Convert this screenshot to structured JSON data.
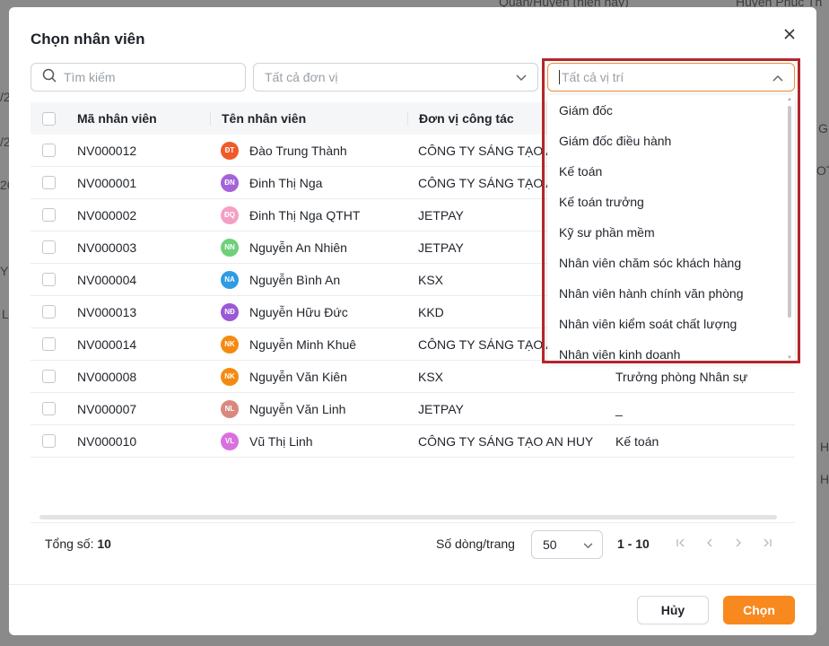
{
  "background": {
    "partial_texts": [
      "Quận/Huyện (hiện nay)",
      "Huyện Phúc Th",
      "/2",
      "/2",
      "26",
      "G",
      "OTH",
      "Y",
      "L",
      "H",
      "H"
    ]
  },
  "modal": {
    "title": "Chọn nhân viên",
    "search": {
      "placeholder": "Tìm kiếm"
    },
    "unit_select": {
      "placeholder": "Tất cả đơn vị"
    },
    "position_select": {
      "placeholder": "Tất cả vị trí"
    },
    "table": {
      "headers": [
        "Mã nhân viên",
        "Tên nhân viên",
        "Đơn vị công tác"
      ],
      "rows": [
        {
          "code": "NV000012",
          "initials": "ĐT",
          "avatar_color": "#f05a28",
          "name": "Đào Trung Thành",
          "unit": "CÔNG TY SÁNG TẠO AN HUY",
          "position": ""
        },
        {
          "code": "NV000001",
          "initials": "ĐN",
          "avatar_color": "#a463d9",
          "name": "Đinh Thị Nga",
          "unit": "CÔNG TY SÁNG TẠO AN HUY",
          "position": ""
        },
        {
          "code": "NV000002",
          "initials": "ĐQ",
          "avatar_color": "#f3a0c4",
          "name": "Đinh Thị Nga QTHT",
          "unit": "JETPAY",
          "position": ""
        },
        {
          "code": "NV000003",
          "initials": "NN",
          "avatar_color": "#6fd07a",
          "name": "Nguyễn An Nhiên",
          "unit": "JETPAY",
          "position": ""
        },
        {
          "code": "NV000004",
          "initials": "NA",
          "avatar_color": "#2f9be3",
          "name": "Nguyễn Bình An",
          "unit": "KSX",
          "position": ""
        },
        {
          "code": "NV000013",
          "initials": "NĐ",
          "avatar_color": "#9b59d6",
          "name": "Nguyễn Hữu Đức",
          "unit": "KKD",
          "position": ""
        },
        {
          "code": "NV000014",
          "initials": "NK",
          "avatar_color": "#f58a12",
          "name": "Nguyễn Minh Khuê",
          "unit": "CÔNG TY SÁNG TẠO AN HUY",
          "position": ""
        },
        {
          "code": "NV000008",
          "initials": "NK",
          "avatar_color": "#f58a12",
          "name": "Nguyễn Văn Kiên",
          "unit": "KSX",
          "position": "Trưởng phòng Nhân sự"
        },
        {
          "code": "NV000007",
          "initials": "NL",
          "avatar_color": "#d98880",
          "name": "Nguyễn Văn Linh",
          "unit": "JETPAY",
          "position": "_"
        },
        {
          "code": "NV000010",
          "initials": "VL",
          "avatar_color": "#d970e0",
          "name": "Vũ Thị Linh",
          "unit": "CÔNG TY SÁNG TẠO AN HUY",
          "position": "Kế toán"
        }
      ]
    },
    "dropdown_options": [
      "Giám đốc",
      "Giám đốc điều hành",
      "Kế toán",
      "Kế toán trưởng",
      "Kỹ sư phần mềm",
      "Nhân viên chăm sóc khách hàng",
      "Nhân viên hành chính văn phòng",
      "Nhân viên kiểm soát chất lượng",
      "Nhân viên kinh doanh"
    ],
    "footer": {
      "total_label": "Tổng số:",
      "total_value": "10",
      "rows_per_page_label": "Số dòng/trang",
      "rows_per_page_value": "50",
      "range": "1 - 10"
    },
    "buttons": {
      "cancel": "Hủy",
      "ok": "Chọn"
    },
    "colors": {
      "accent": "#f7891f",
      "highlight": "#b3262a"
    }
  }
}
